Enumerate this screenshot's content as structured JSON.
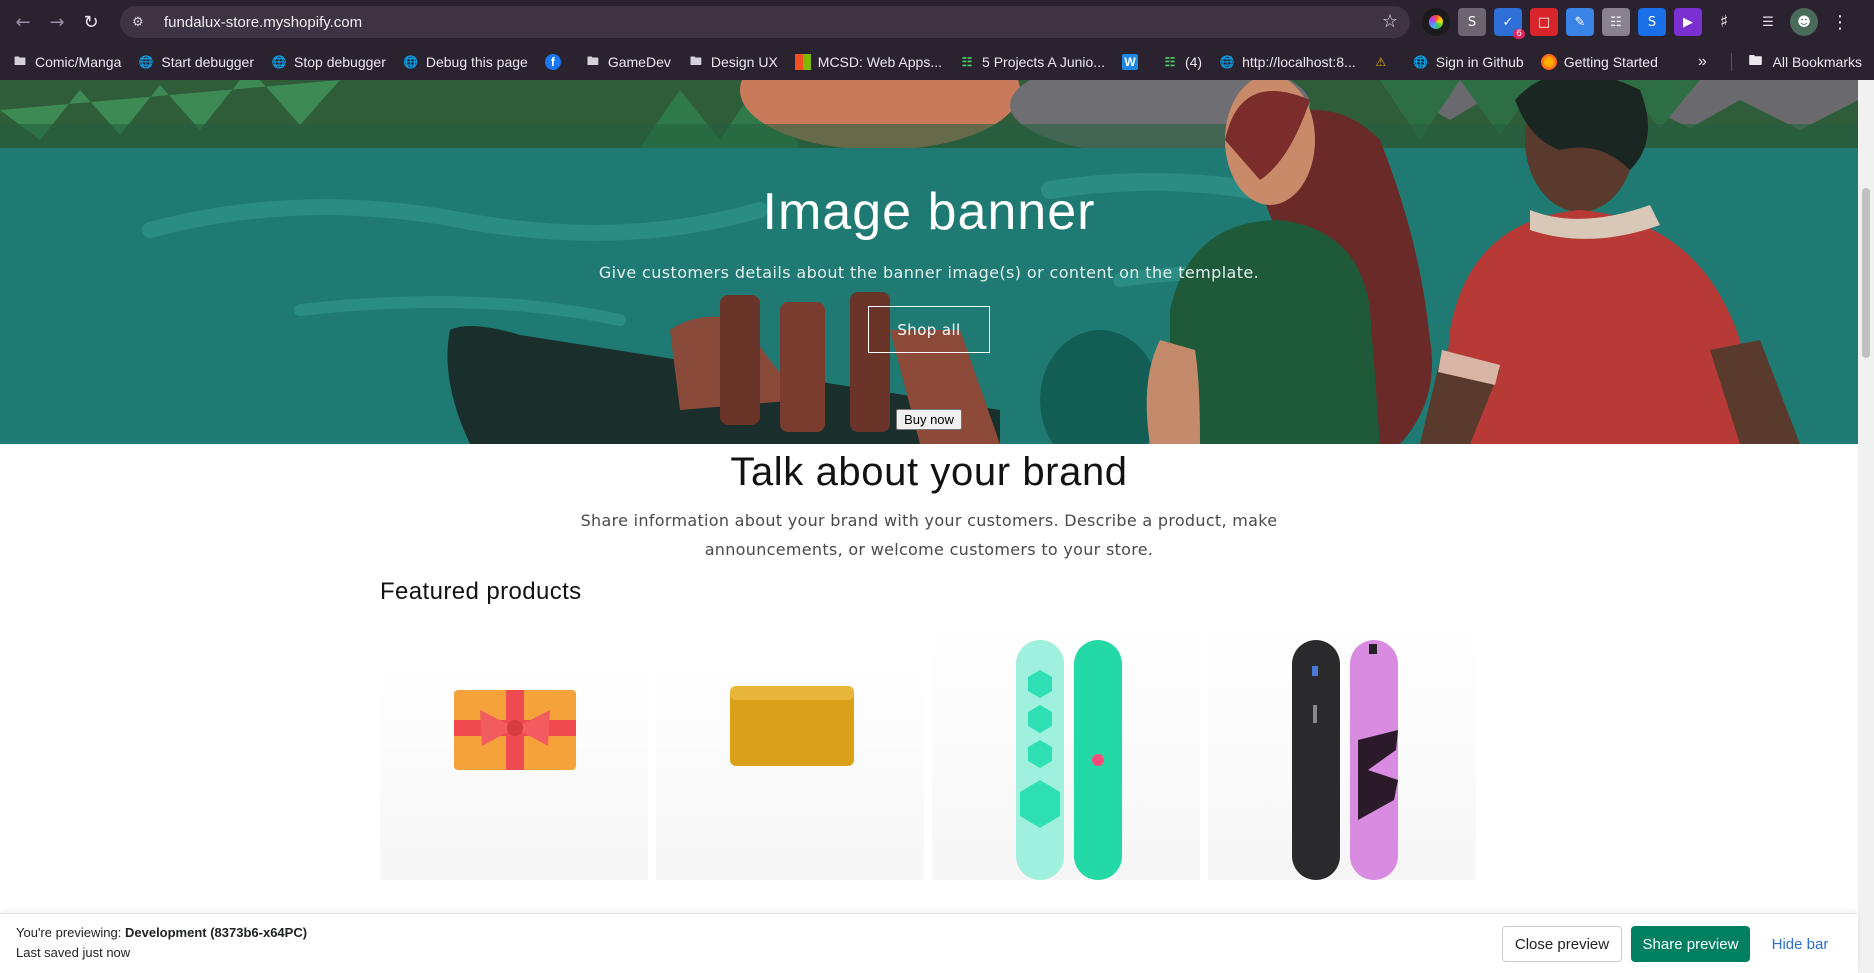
{
  "browser": {
    "url": "fundalux-store.myshopify.com",
    "extension_badge": "6",
    "bookmarks": [
      {
        "label": "Comic/Manga",
        "icon": "folder-icon"
      },
      {
        "label": "Start debugger",
        "icon": "globe-icon"
      },
      {
        "label": "Stop debugger",
        "icon": "globe-icon"
      },
      {
        "label": "Debug this page",
        "icon": "globe-icon"
      },
      {
        "label": "",
        "icon": "facebook-icon"
      },
      {
        "label": "GameDev",
        "icon": "folder-icon"
      },
      {
        "label": "Design UX",
        "icon": "folder-icon"
      },
      {
        "label": "MCSD: Web Apps...",
        "icon": "microsoft-icon"
      },
      {
        "label": "5 Projects A Junio...",
        "icon": "hashnode-icon"
      },
      {
        "label": "",
        "icon": "w-icon"
      },
      {
        "label": "(4)",
        "icon": "hashnode-icon"
      },
      {
        "label": "http://localhost:8...",
        "icon": "globe-icon"
      },
      {
        "label": "",
        "icon": "warning-icon"
      },
      {
        "label": "Sign in Github",
        "icon": "globe-icon"
      },
      {
        "label": "Getting Started",
        "icon": "firefox-icon"
      }
    ],
    "all_bookmarks": "All Bookmarks"
  },
  "banner": {
    "title": "Image banner",
    "subtitle": "Give customers details about the banner image(s) or content on the template.",
    "button": "Shop all"
  },
  "content": {
    "buy_now": "Buy now",
    "brand_title": "Talk about your brand",
    "brand_text": "Share information about your brand with your customers. Describe a product, make announcements, or welcome customers to your store.",
    "featured_title": "Featured products"
  },
  "preview_bar": {
    "previewing_prefix": "You're previewing:",
    "theme_name": "Development (8373b6-x64PC)",
    "saved": "Last saved just now",
    "close": "Close preview",
    "share": "Share preview",
    "hide": "Hide bar"
  },
  "colors": {
    "chrome_bg": "#2b2230",
    "banner_teal": "#1e7a72",
    "share_green": "#008060",
    "hide_link": "#2c6ecb"
  }
}
